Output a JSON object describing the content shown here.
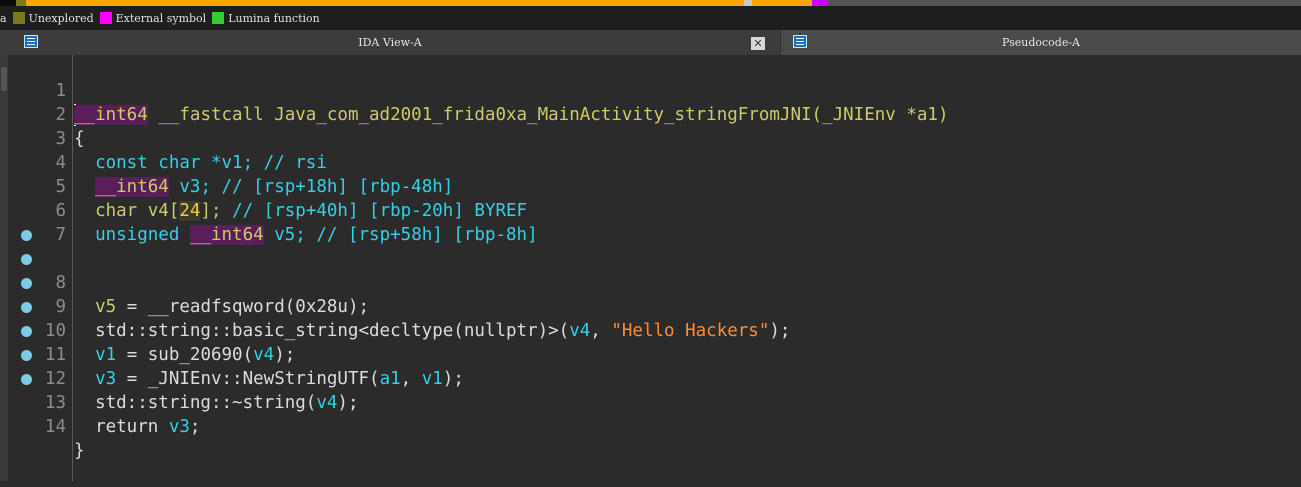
{
  "nav_band": {
    "colors": [
      "#0b0b0b",
      "#7a7a1a",
      "#ffa500",
      "#c8c8c8",
      "#ffa500",
      "#d000ff",
      "#555555"
    ]
  },
  "legend": [
    {
      "label": "a",
      "color": "#7a7a1a",
      "partial": true
    },
    {
      "label": "Unexplored",
      "color": "#7a7a1a"
    },
    {
      "label": "External symbol",
      "color": "#ff00ff"
    },
    {
      "label": "Lumina function",
      "color": "#33cc33"
    }
  ],
  "tabs": {
    "ida_view": {
      "title": "IDA View-A",
      "close_label": "✕"
    },
    "pseudocode": {
      "title": "Pseudocode-A"
    }
  },
  "code": {
    "l1": {
      "num": "1",
      "t1": "__int64",
      "t2": " __fastcall Java_com_ad2001_frida0xa_MainActivity_stringFromJNI(",
      "t3": "_JNIEnv",
      "t4": " *a1)"
    },
    "l2": {
      "num": "2",
      "t1": "{"
    },
    "l3": {
      "num": "3",
      "t1": "  const char *",
      "t2": "v1",
      "t3": "; // rsi"
    },
    "l4": {
      "num": "4",
      "t1": "  ",
      "t2": "__int64",
      "t3": " ",
      "t4": "v3",
      "t5": "; // [rsp+18h] [rbp-48h]"
    },
    "l5": {
      "num": "5",
      "t1": "  char ",
      "t2": "v4",
      "t3": "[",
      "t4": "24",
      "t5": "]; ",
      "t6": "// [rsp+40h] [rbp-20h] BYREF"
    },
    "l6": {
      "num": "6",
      "t1": "  unsigned ",
      "t2": "__int64",
      "t3": " ",
      "t4": "v5",
      "t5": "; // [rsp+58h] [rbp-8h]"
    },
    "l7": {
      "num": "7"
    },
    "l8": {
      "num": "8",
      "t1": "  ",
      "t2": "v5",
      "t3": " = __readfsqword(",
      "t4": "0x28u",
      "t5": ");"
    },
    "l9": {
      "num": "9",
      "t1": "  std::string::basic_string<decltype(nullptr)>(",
      "t2": "v4",
      "t3": ", ",
      "t4": "\"Hello Hackers\"",
      "t5": ");"
    },
    "l10": {
      "num": "10",
      "t1": "  ",
      "t2": "v1",
      "t3": " = sub_20690(",
      "t4": "v4",
      "t5": ");"
    },
    "l11": {
      "num": "11",
      "t1": "  ",
      "t2": "v3",
      "t3": " = _JNIEnv::NewStringUTF(",
      "t4": "a1",
      "t5": ", ",
      "t6": "v1",
      "t7": ");"
    },
    "l12": {
      "num": "12",
      "t1": "  std::string::~string(",
      "t2": "v4",
      "t3": ");"
    },
    "l13": {
      "num": "13",
      "t1": "  return ",
      "t2": "v3",
      "t3": ";"
    },
    "l14": {
      "num": "14",
      "t1": "}"
    }
  },
  "breakpoint_color": "#7ec9e8"
}
